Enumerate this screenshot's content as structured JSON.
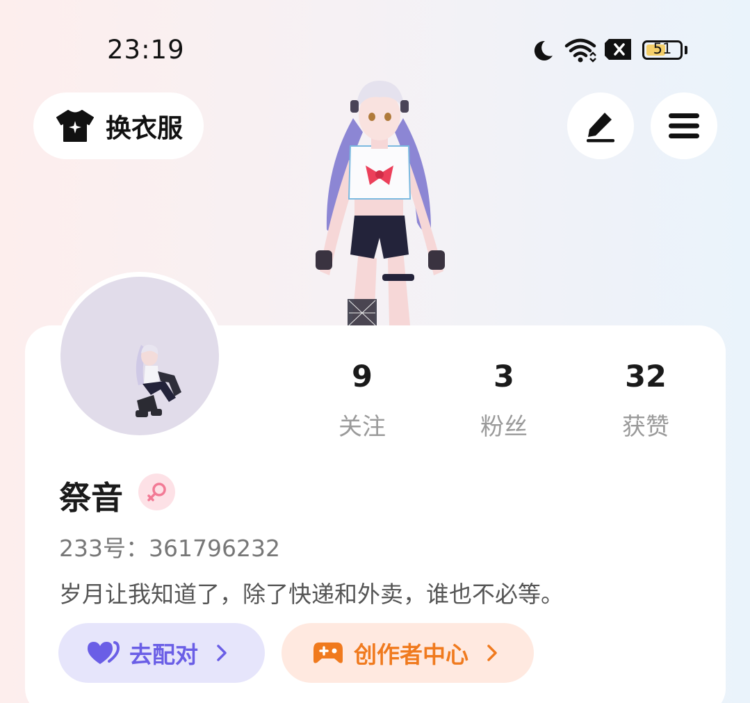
{
  "status_bar": {
    "time": "23:19",
    "battery_level": "51",
    "icons": [
      "moon-icon",
      "wifi-icon",
      "sim-off-icon",
      "battery-icon"
    ]
  },
  "header": {
    "outfit_button_label": "换衣服",
    "edit_icon": "pen-icon",
    "menu_icon": "hamburger-icon"
  },
  "profile": {
    "stats": [
      {
        "value": "9",
        "label": "关注"
      },
      {
        "value": "3",
        "label": "粉丝"
      },
      {
        "value": "32",
        "label": "获赞"
      }
    ],
    "username": "祭音",
    "id_text": "233号：361796232",
    "bio": "岁月让我知道了，除了快递和外卖，谁也不必等。",
    "buttons": {
      "match_label": "去配对",
      "creator_label": "创作者中心"
    }
  },
  "colors": {
    "match_accent": "#6a5ee6",
    "creator_accent": "#f07a1e",
    "gender_female": "#f27a95"
  }
}
